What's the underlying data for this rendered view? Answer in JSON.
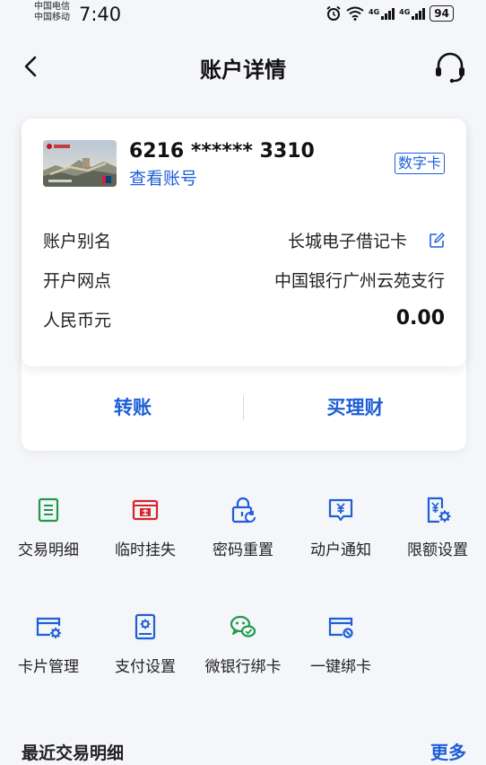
{
  "status_bar": {
    "carrier_1": "中国电信",
    "carrier_2": "中国移动",
    "time": "7:40",
    "net_1": "4G",
    "net_2": "4G",
    "battery": "94"
  },
  "navbar": {
    "title": "账户详情",
    "back_icon": "chevron-left-icon",
    "service_icon": "headset-icon"
  },
  "account_card": {
    "card_number": "6216 ****** 3310",
    "view_account": "查看账号",
    "badge": "数字卡",
    "rows": [
      {
        "label": "账户别名",
        "value": "长城电子借记卡"
      },
      {
        "label": "开户网点",
        "value": "中国银行广州云苑支行"
      },
      {
        "label": "人民币元",
        "value": "0.00"
      }
    ],
    "actions": {
      "transfer": "转账",
      "wealth": "买理财"
    }
  },
  "functions": [
    {
      "label": "交易明细",
      "icon": "transaction-list-icon",
      "color": "#1e9a4a"
    },
    {
      "label": "临时挂失",
      "icon": "card-loss-icon",
      "color": "#d8232a"
    },
    {
      "label": "密码重置",
      "icon": "lock-reset-icon",
      "color": "#1e5fd8"
    },
    {
      "label": "动户通知",
      "icon": "notification-yuan-icon",
      "color": "#1e5fd8"
    },
    {
      "label": "限额设置",
      "icon": "limit-settings-icon",
      "color": "#1e5fd8"
    },
    {
      "label": "卡片管理",
      "icon": "card-manage-icon",
      "color": "#1e5fd8"
    },
    {
      "label": "支付设置",
      "icon": "payment-settings-icon",
      "color": "#1e5fd8"
    },
    {
      "label": "微银行绑卡",
      "icon": "wechat-bind-icon",
      "color": "#1e9a4a"
    },
    {
      "label": "一键绑卡",
      "icon": "quick-bind-icon",
      "color": "#1e5fd8"
    }
  ],
  "recent": {
    "title": "最近交易明细",
    "more": "更多"
  },
  "colors": {
    "accent": "#1e5fd8",
    "green": "#1e9a4a",
    "red": "#d8232a",
    "background": "#f4f6f9"
  }
}
